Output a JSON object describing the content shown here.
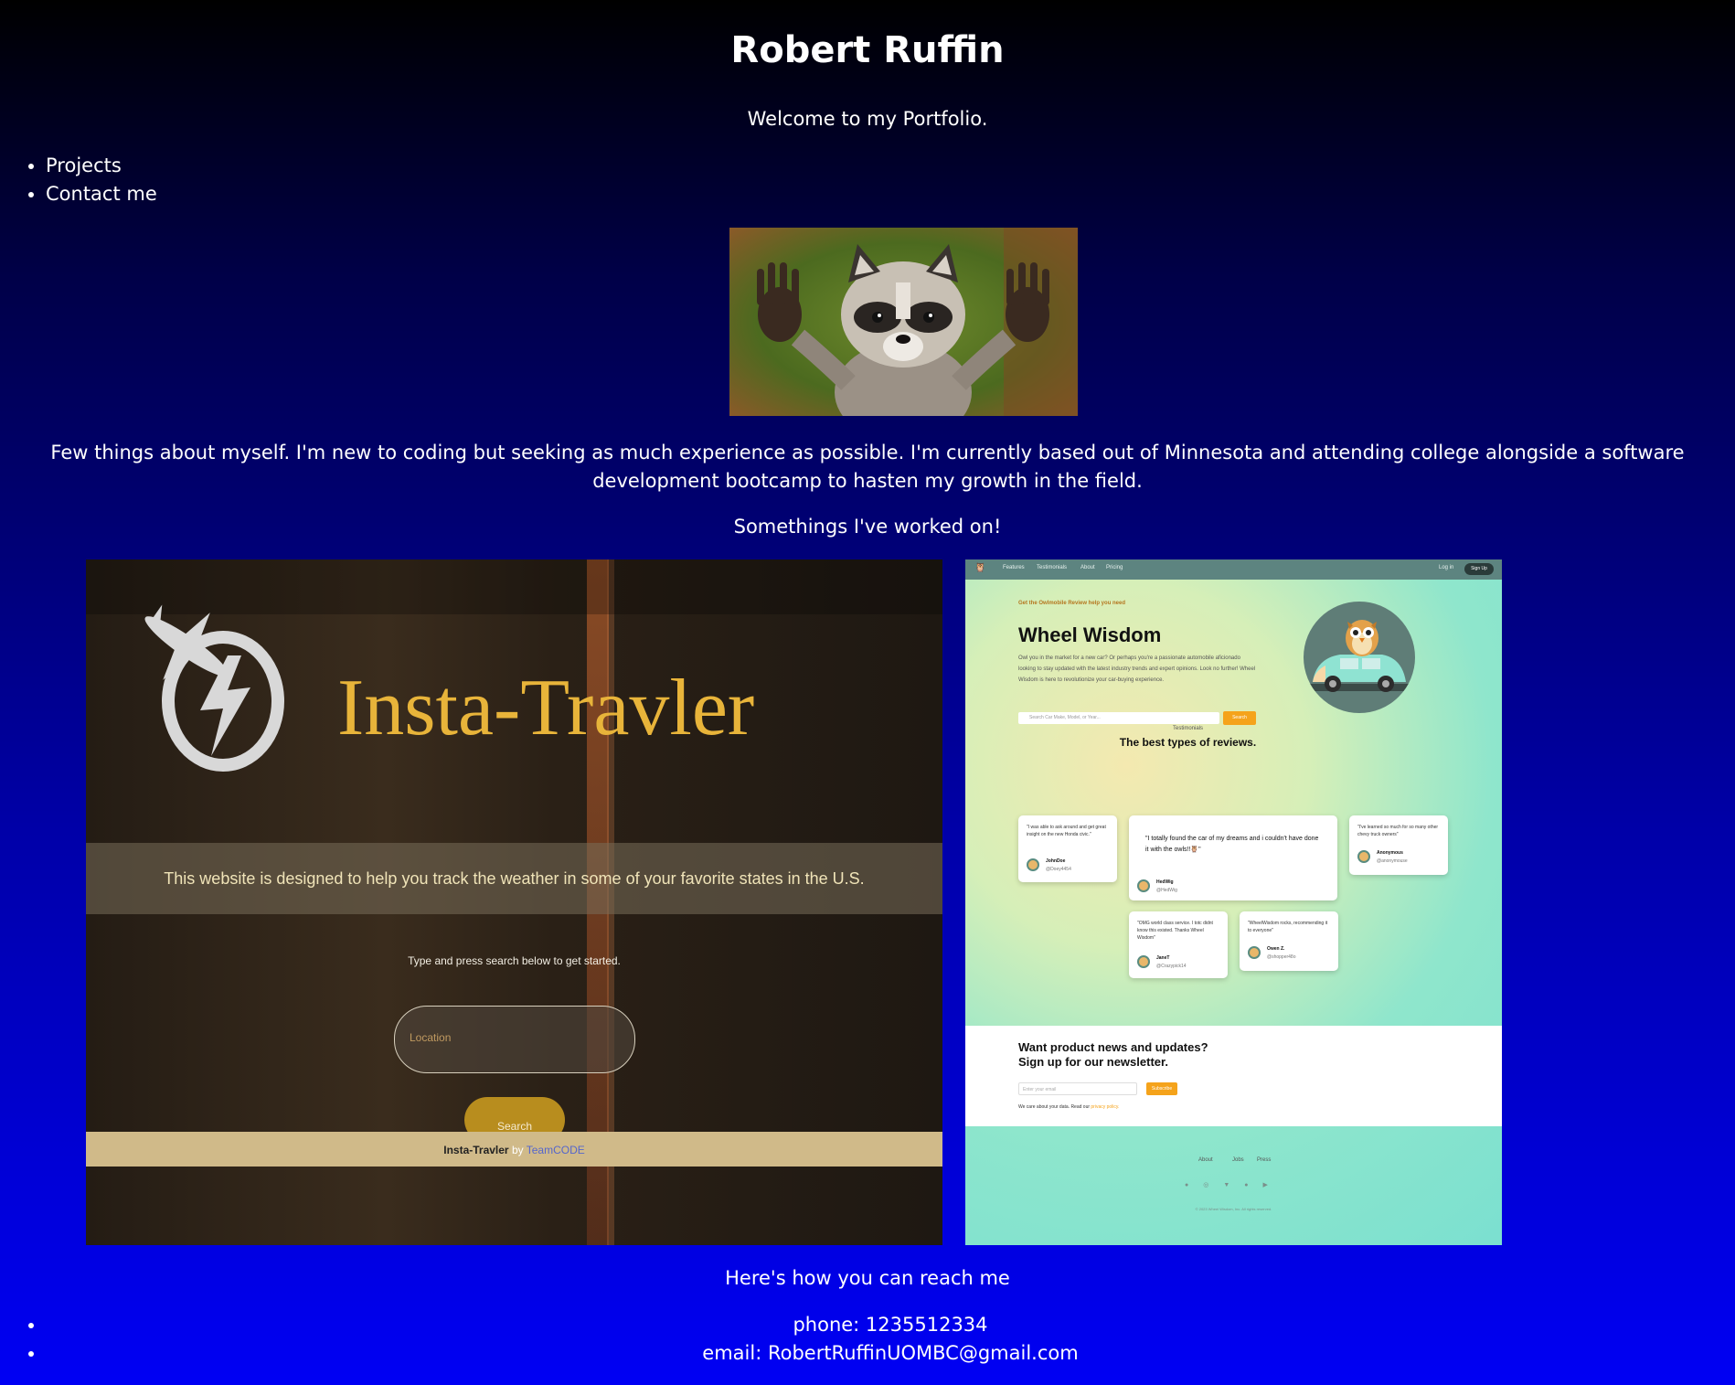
{
  "header": {
    "title": "Robert Ruffin",
    "welcome": "Welcome to my Portfolio."
  },
  "nav": {
    "items": [
      "Projects",
      "Contact me"
    ]
  },
  "about": {
    "text": "Few things about myself. I'm new to coding but seeking as much experience as possible. I'm currently based out of Minnesota and attending college alongside a software development bootcamp to hasten my growth in the field."
  },
  "projects": {
    "heading": "Somethings I've worked on!",
    "insta": {
      "title": "Insta-Travler",
      "banner": "This website is designed to help you track the weather in some of your favorite states in the U.S.",
      "hint": "Type and press search below to get started.",
      "location_placeholder": "Location",
      "search_label": "Search",
      "footer_brand": "Insta-Travler",
      "footer_by": " by ",
      "footer_team": "TeamCODE"
    },
    "wheel": {
      "nav_items": [
        "Features",
        "Testimonials",
        "About",
        "Pricing"
      ],
      "login": "Log in",
      "signup": "Sign Up",
      "eyebrow": "Get the Owlmobile Review help you need",
      "title": "Wheel Wisdom",
      "description": "Owl you in the market for a new car? Or perhaps you're a passionate automobile aficionado looking to stay updated with the latest industry trends and expert opinions. Look no further! Wheel Wisdom is here to revolutionize your car-buying experience.",
      "search_placeholder": "Search Car Make, Model, or Year...",
      "search_label": "Search",
      "testimonials_eyebrow": "Testimonials",
      "testimonials_title": "The best types of reviews.",
      "reviews": [
        {
          "quote": "\"I was able to ask around and get great insight on the new Honda civic.\"",
          "name": "JohnDoe",
          "handle": "@Doey4454"
        },
        {
          "quote": "\"I totally found the car of my dreams and i couldn't have done it with the owls!!🦉\"",
          "name": "HedWig",
          "handle": "@HedWig"
        },
        {
          "quote": "\"I've learned so much for so many other chevy truck owners\"",
          "name": "Anonymous",
          "handle": "@anonymouse"
        },
        {
          "quote": "\"OMG world class service. I totc didnt know this existed. Thanks Wheel Wisdom\"",
          "name": "JaneT",
          "handle": "@Crazypick14"
        },
        {
          "quote": "\"WheelWisdom rocks, recommending it to everyone\"",
          "name": "Owen Z.",
          "handle": "@shopper48o"
        }
      ],
      "newsletter_title": "Want product news and updates?",
      "newsletter_sub": "Sign up for our newsletter.",
      "email_placeholder": "Enter your email",
      "subscribe_label": "Subscribe",
      "privacy_text": "We care about your data. Read our ",
      "privacy_link": "privacy policy.",
      "footer_links": [
        "About",
        "Jobs",
        "Press"
      ],
      "copyright": "© 2023 Wheel Wisdom, Inc. All rights reserved."
    }
  },
  "contact": {
    "heading": "Here's how you can reach me",
    "phone": "phone: 1235512334",
    "email": "email: RobertRuffinUOMBC@gmail.com"
  }
}
